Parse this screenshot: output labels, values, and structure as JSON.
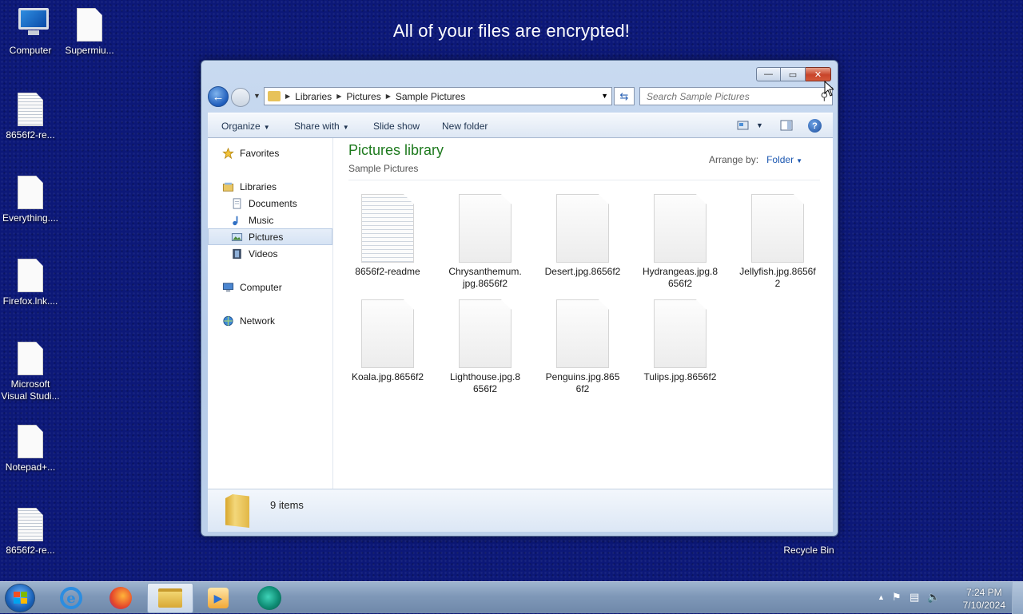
{
  "banner": {
    "text": "All of your files are encrypted!"
  },
  "desktop_icons": [
    {
      "label": "Computer",
      "icon": "computer-icon"
    },
    {
      "label": "Supermiu...",
      "icon": "document-icon"
    },
    {
      "label": "8656f2-re...",
      "icon": "text-document-icon"
    },
    {
      "label": "Everything....",
      "icon": "document-icon"
    },
    {
      "label": "Firefox.lnk....",
      "icon": "document-icon"
    },
    {
      "label_line1": "Microsoft",
      "label_line2": "Visual Studi...",
      "icon": "document-icon"
    },
    {
      "label": "Notepad+...",
      "icon": "document-icon"
    },
    {
      "label": "8656f2-re...",
      "icon": "text-document-icon"
    },
    {
      "label": "Recycle Bin",
      "icon": "recycle-bin-icon"
    }
  ],
  "window": {
    "caption_buttons": {
      "minimize": "—",
      "maximize": "▭",
      "close": "✕"
    },
    "address": {
      "crumbs": [
        "Libraries",
        "Pictures",
        "Sample Pictures"
      ]
    },
    "search": {
      "placeholder": "Search Sample Pictures"
    },
    "toolbar": {
      "organize": "Organize",
      "share_with": "Share with",
      "slide_show": "Slide show",
      "new_folder": "New folder",
      "help": "?"
    },
    "nav_pane": {
      "favorites": "Favorites",
      "libraries": "Libraries",
      "documents": "Documents",
      "music": "Music",
      "pictures": "Pictures",
      "videos": "Videos",
      "computer": "Computer",
      "network": "Network",
      "selected": "Pictures"
    },
    "content": {
      "title": "Pictures library",
      "subtitle": "Sample Pictures",
      "arrange_label": "Arrange by:",
      "arrange_value": "Folder"
    },
    "files": [
      {
        "line1": "8656f2-readme",
        "line2": "",
        "lined": true
      },
      {
        "line1": "Chrysanthemum.",
        "line2": "jpg.8656f2",
        "lined": false
      },
      {
        "line1": "Desert.jpg.8656f2",
        "line2": "",
        "lined": false
      },
      {
        "line1": "Hydrangeas.jpg.8",
        "line2": "656f2",
        "lined": false
      },
      {
        "line1": "Jellyfish.jpg.8656f",
        "line2": "2",
        "lined": false
      },
      {
        "line1": "Koala.jpg.8656f2",
        "line2": "",
        "lined": false
      },
      {
        "line1": "Lighthouse.jpg.8",
        "line2": "656f2",
        "lined": false
      },
      {
        "line1": "Penguins.jpg.865",
        "line2": "6f2",
        "lined": false
      },
      {
        "line1": "Tulips.jpg.8656f2",
        "line2": "",
        "lined": false
      }
    ],
    "details": {
      "count": "9 items"
    }
  },
  "taskbar": {
    "apps": [
      {
        "name": "internet-explorer",
        "active": false
      },
      {
        "name": "firefox",
        "active": false
      },
      {
        "name": "windows-explorer",
        "active": true
      },
      {
        "name": "media-player",
        "active": false
      },
      {
        "name": "eye-app",
        "active": false
      }
    ],
    "clock": {
      "time": "7:24 PM",
      "date": "7/10/2024"
    }
  },
  "colors": {
    "desktop_bg": "#0c1878",
    "library_title": "#1e7a1e",
    "link_blue": "#1a56b0",
    "close_red": "#c8442a"
  }
}
